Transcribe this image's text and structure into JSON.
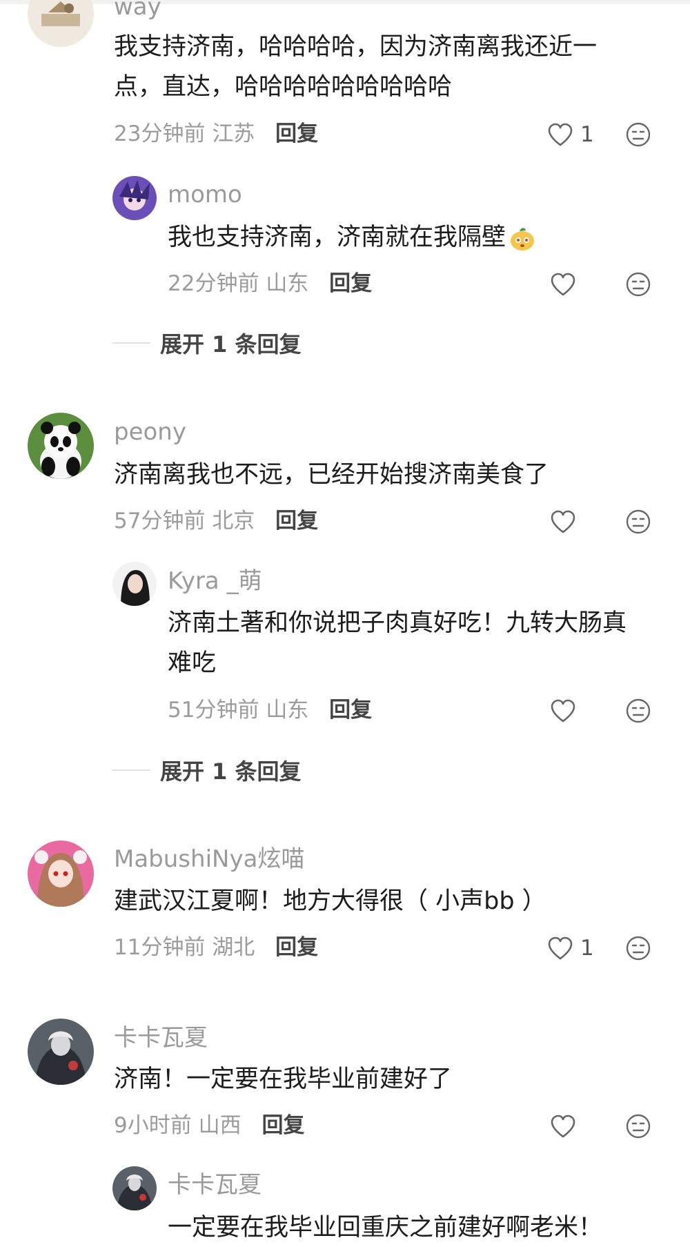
{
  "comments": [
    {
      "user": "way",
      "text_lines": [
        "我支持济南，哈哈哈哈，因为济南离我还近一",
        "点，直达，哈哈哈哈哈哈哈哈哈"
      ],
      "time": "23分钟前",
      "location": "江苏",
      "reply_label": "回复",
      "like_count": "1",
      "replies": [
        {
          "user": "momo",
          "text": "我也支持济南，济南就在我隔壁",
          "emoji": "sticker-emoji",
          "time": "22分钟前",
          "location": "山东",
          "reply_label": "回复"
        }
      ],
      "expand_label": "展开 1 条回复"
    },
    {
      "user": "peony",
      "text_lines": [
        "济南离我也不远，已经开始搜济南美食了"
      ],
      "time": "57分钟前",
      "location": "北京",
      "reply_label": "回复",
      "replies": [
        {
          "user": "Kyra _萌",
          "text_lines": [
            "济南土著和你说把子肉真好吃！九转大肠真",
            "难吃"
          ],
          "time": "51分钟前",
          "location": "山东",
          "reply_label": "回复"
        }
      ],
      "expand_label": "展开 1 条回复"
    },
    {
      "user": "MabushiNya炫喵",
      "text_lines": [
        "建武汉江夏啊！地方大得很（ 小声bb ）"
      ],
      "time": "11分钟前",
      "location": "湖北",
      "reply_label": "回复",
      "like_count": "1"
    },
    {
      "user": "卡卡瓦夏",
      "text_lines": [
        "济南！一定要在我毕业前建好了"
      ],
      "time": "9小时前",
      "location": "山西",
      "reply_label": "回复",
      "replies": [
        {
          "user": "卡卡瓦夏",
          "text": "一定要在我毕业回重庆之前建好啊老米！"
        }
      ]
    }
  ],
  "icons": {
    "like": "heart-outline-icon",
    "dislike": "meh-face-icon"
  },
  "colors": {
    "meta_gray": "#9b9b9b",
    "username_gray": "#9a9a9a",
    "reply_dark": "#444444",
    "text": "#1c1c1c"
  }
}
